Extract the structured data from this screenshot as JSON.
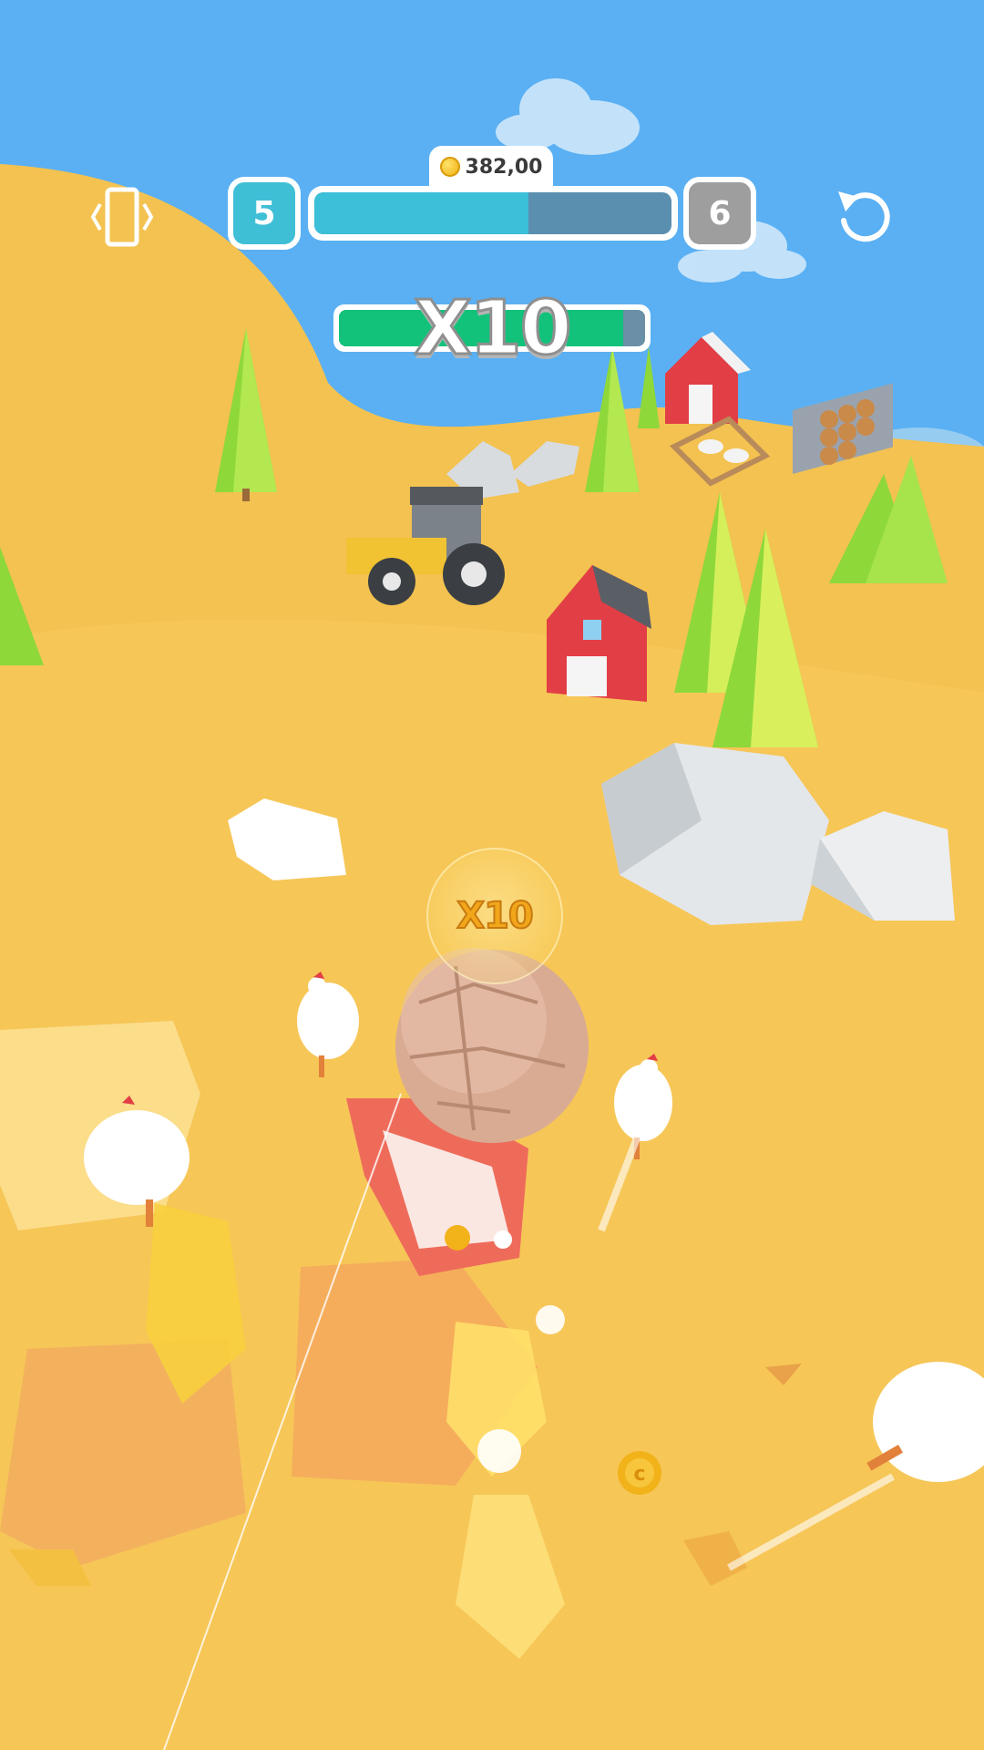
{
  "hud": {
    "coins": "382,00",
    "level_current": "5",
    "level_next": "6",
    "level_progress": 0.6,
    "multiplier_label": "X10",
    "multiplier_progress": 0.93
  },
  "icons": {
    "rotate": "rotate-device-icon",
    "restart": "restart-icon",
    "coin": "coin-icon"
  },
  "ball": {
    "multiplier_label": "X10"
  },
  "colors": {
    "sky_top": "#4aa8f2",
    "ground": "#f4c450",
    "progress_fill": "#3cbfd8",
    "multiplier_fill": "#12c27a"
  }
}
